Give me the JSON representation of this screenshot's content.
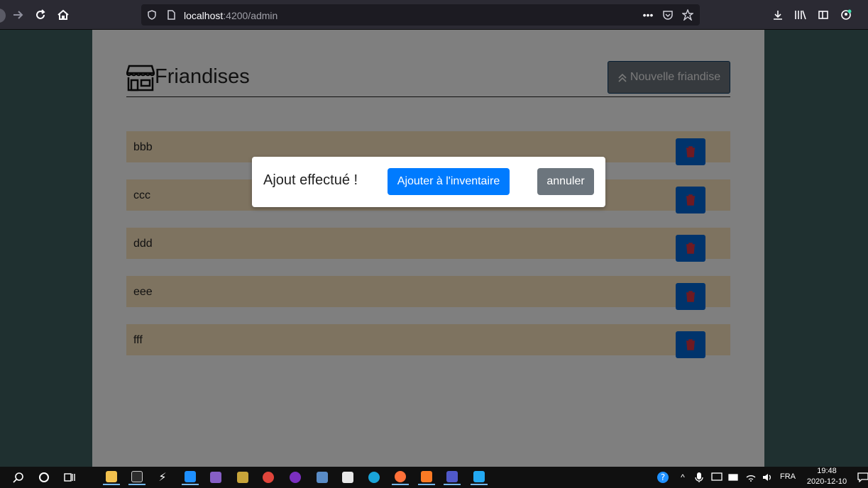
{
  "browser": {
    "url_host": "localhost",
    "url_path": ":4200/admin"
  },
  "page": {
    "title": "Friandises",
    "new_button_label": "Nouvelle friandise",
    "items": [
      {
        "label": "bbb"
      },
      {
        "label": "ccc"
      },
      {
        "label": "ddd"
      },
      {
        "label": "eee"
      },
      {
        "label": "fff"
      }
    ]
  },
  "modal": {
    "message": "Ajout effectué !",
    "primary_label": "Ajouter à l'inventaire",
    "cancel_label": "annuler"
  },
  "taskbar": {
    "language": "FRA",
    "time": "19:48",
    "date": "2020-12-10"
  },
  "colors": {
    "primary": "#007bff",
    "secondary": "#6c757d",
    "item_bg": "#fde6c1",
    "delete_icon": "#dc3545"
  }
}
